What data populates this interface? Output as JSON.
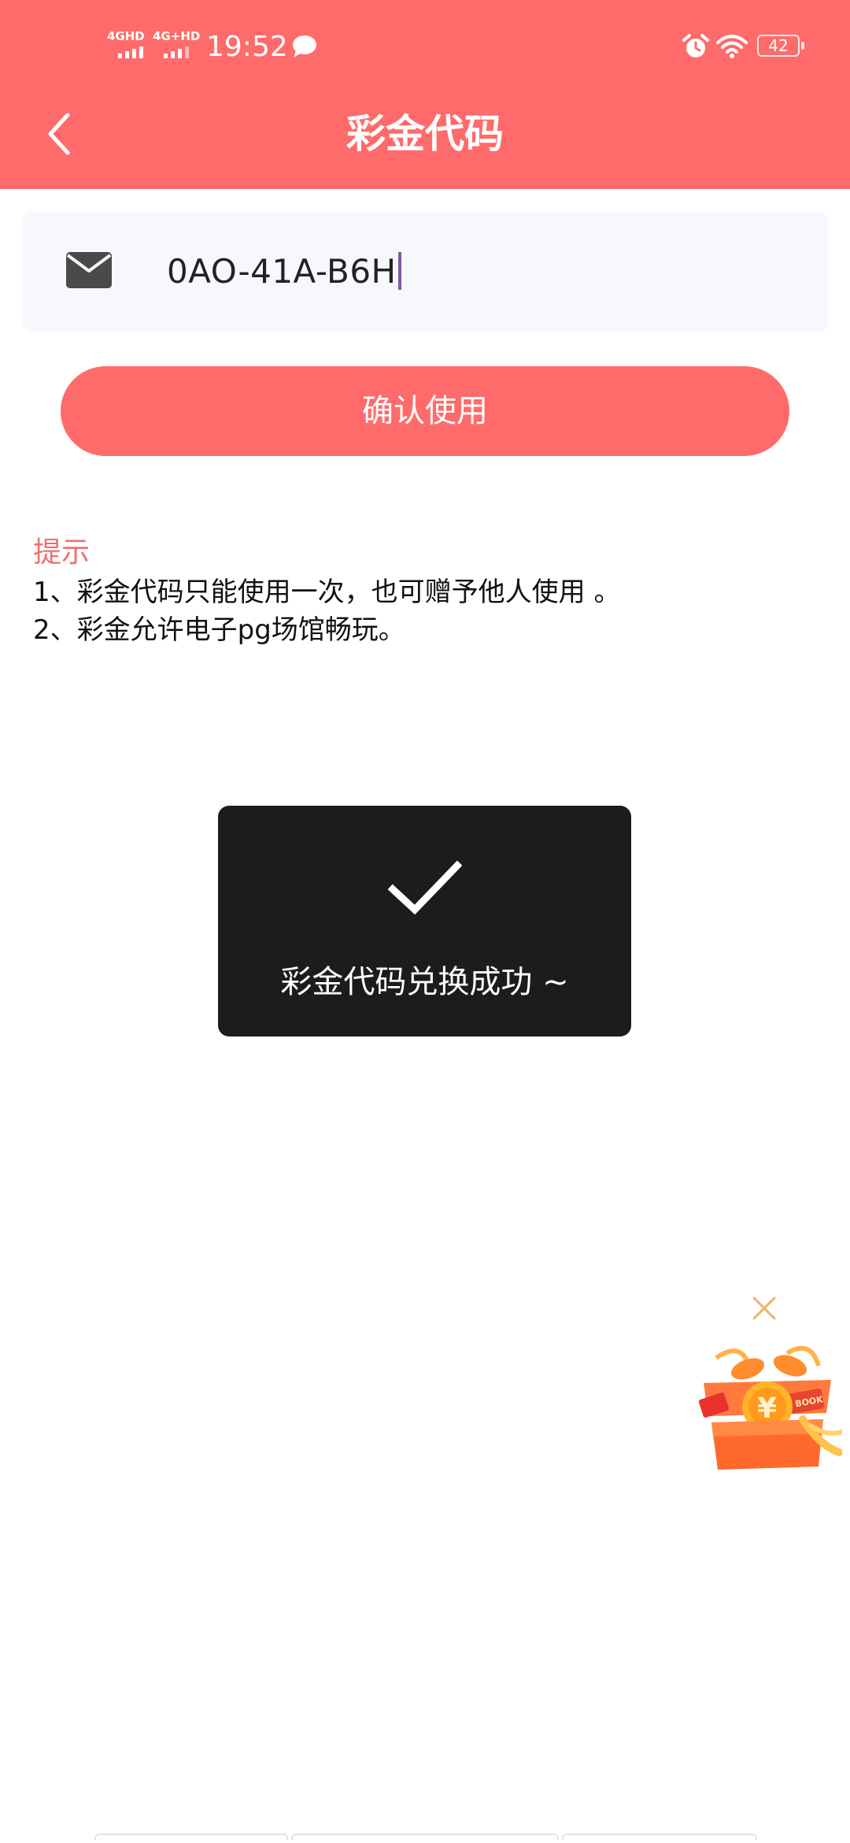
{
  "status_bar": {
    "signal1_label": "4GHD",
    "signal2_label": "4G+HD",
    "time": "19:52",
    "battery": "42"
  },
  "header": {
    "title": "彩金代码"
  },
  "code_input": {
    "value": "0AO-41A-B6H"
  },
  "confirm_button": {
    "label": "确认使用"
  },
  "tips": {
    "title": "提示",
    "lines": [
      "1、彩金代码只能使用一次，也可赠予他人使用 。",
      "2、彩金允许电子pg场馆畅玩。"
    ]
  },
  "toast": {
    "message": "彩金代码兑换成功 ~"
  },
  "gift": {
    "coin_symbol": "¥",
    "tag_label": "BOOK"
  },
  "colors": {
    "brand": "#ff6b6b",
    "tips_title": "#ef6f6f",
    "toast_bg": "#1c1c1c",
    "input_bg": "#f7f8fd"
  }
}
